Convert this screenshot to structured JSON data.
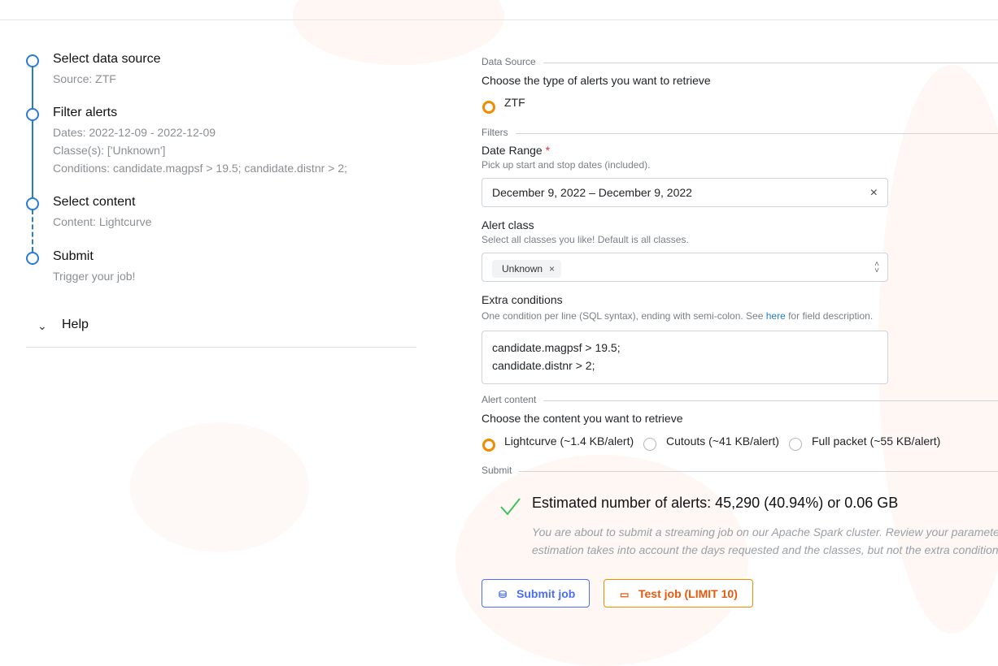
{
  "stepper": {
    "steps": [
      {
        "title": "Select data source",
        "lines": [
          "Source: ZTF"
        ]
      },
      {
        "title": "Filter alerts",
        "lines": [
          "Dates: 2022-12-09 - 2022-12-09",
          "Classe(s): ['Unknown']",
          "Conditions: candidate.magpsf > 19.5; candidate.distnr > 2;"
        ]
      },
      {
        "title": "Select content",
        "lines": [
          "Content: Lightcurve"
        ]
      },
      {
        "title": "Submit",
        "lines": [
          "Trigger your job!"
        ]
      }
    ]
  },
  "help": {
    "label": "Help",
    "chevron": "⌄"
  },
  "form": {
    "data_source": {
      "legend": "Data Source",
      "label": "Choose the type of alerts you want to retrieve",
      "option": "ZTF"
    },
    "filters": {
      "legend": "Filters",
      "date_range_label": "Date Range",
      "required_mark": "*",
      "date_range_hint": "Pick up start and stop dates (included).",
      "date_range_value": "December 9, 2022 – December 9, 2022",
      "clear_glyph": "×",
      "alert_class_label": "Alert class",
      "alert_class_hint": "Select all classes you like! Default is all classes.",
      "alert_class_pill": "Unknown",
      "pill_remove": "×",
      "extra_label": "Extra conditions",
      "extra_hint_pre": "One condition per line (SQL syntax), ending with semi-colon. See ",
      "extra_hint_link": "here",
      "extra_hint_post": " for field description.",
      "extra_line_1": "candidate.magpsf > 19.5;",
      "extra_line_2": "candidate.distnr > 2;"
    },
    "alert_content": {
      "legend": "Alert content",
      "label": "Choose the content you want to retrieve",
      "options": [
        "Lightcurve (~1.4 KB/alert)",
        "Cutouts (~41 KB/alert)",
        "Full packet (~55 KB/alert)"
      ]
    },
    "submit": {
      "legend": "Submit",
      "estimate": "Estimated number of alerts: 45,290 (40.94%) or 0.06 GB",
      "note_1": "You are about to submit a streaming job on our Apache Spark cluster. Review your paramete",
      "note_2": "estimation takes into account the days requested and the classes, but not the extra conditions",
      "submit_label": "Submit job",
      "test_label": "Test job (LIMIT 10)"
    }
  },
  "colors": {
    "accent_blue": "#2b7bd0",
    "radio_orange": "#f08c00",
    "submit_blue": "#4c6ef5",
    "check_green": "#40c057"
  }
}
